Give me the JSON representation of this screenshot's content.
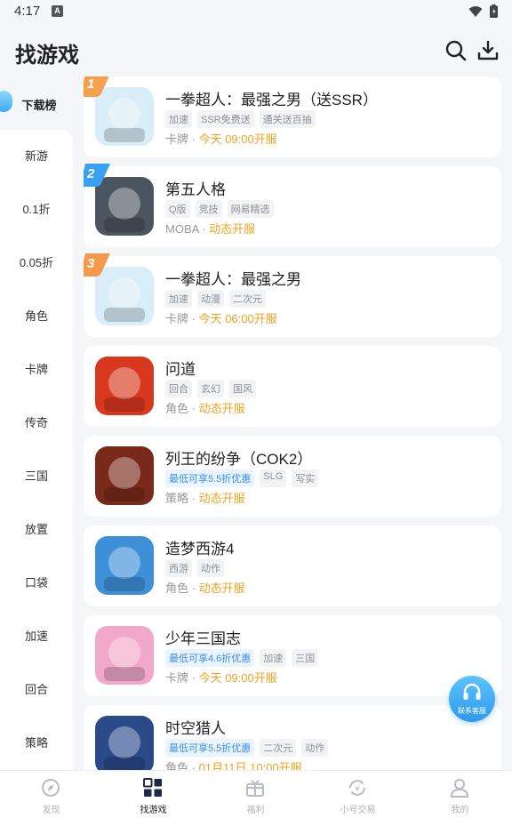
{
  "status": {
    "time": "4:17",
    "notif": "A"
  },
  "header": {
    "title": "找游戏"
  },
  "sidebar": {
    "active": "下载榜",
    "items": [
      "新游",
      "0.1折",
      "0.05折",
      "角色",
      "卡牌",
      "传奇",
      "三国",
      "放置",
      "口袋",
      "加速",
      "回合",
      "策略"
    ]
  },
  "games": [
    {
      "rank": "1",
      "name": "一拳超人：最强之男（送SSR）",
      "tags": [
        {
          "t": "加速"
        },
        {
          "t": "SSR免费送"
        },
        {
          "t": "通关送百抽"
        }
      ],
      "genre": "卡牌",
      "schedule": "今天 09:00开服",
      "icon_color": "#d9eef8"
    },
    {
      "rank": "2",
      "name": "第五人格",
      "tags": [
        {
          "t": "Q版"
        },
        {
          "t": "竞技"
        },
        {
          "t": "网易精选"
        }
      ],
      "genre": "MOBA",
      "schedule": "动态开服",
      "icon_color": "#4a5560"
    },
    {
      "rank": "3",
      "name": "一拳超人：最强之男",
      "tags": [
        {
          "t": "加速"
        },
        {
          "t": "动漫"
        },
        {
          "t": "二次元"
        }
      ],
      "genre": "卡牌",
      "schedule": "今天 06:00开服",
      "icon_color": "#d9eef8"
    },
    {
      "rank": "",
      "name": "问道",
      "tags": [
        {
          "t": "回合"
        },
        {
          "t": "玄幻"
        },
        {
          "t": "国风"
        }
      ],
      "genre": "角色",
      "schedule": "动态开服",
      "icon_color": "#d8381d"
    },
    {
      "rank": "",
      "name": "列王的纷争（COK2）",
      "tags": [
        {
          "t": "最低可享5.5折优惠",
          "blue": true
        },
        {
          "t": "SLG"
        },
        {
          "t": "写实"
        }
      ],
      "genre": "策略",
      "schedule": "动态开服",
      "icon_color": "#7a2a1a"
    },
    {
      "rank": "",
      "name": "造梦西游4",
      "tags": [
        {
          "t": "西游"
        },
        {
          "t": "动作"
        }
      ],
      "genre": "角色",
      "schedule": "动态开服",
      "icon_color": "#3d8fd8"
    },
    {
      "rank": "",
      "name": "少年三国志",
      "tags": [
        {
          "t": "最低可享4.6折优惠",
          "blue": true
        },
        {
          "t": "加速"
        },
        {
          "t": "三国"
        }
      ],
      "genre": "卡牌",
      "schedule": "今天 09:00开服",
      "icon_color": "#f2a8c8"
    },
    {
      "rank": "",
      "name": "时空猎人",
      "tags": [
        {
          "t": "最低可享5.5折优惠",
          "blue": true
        },
        {
          "t": "二次元"
        },
        {
          "t": "动作"
        }
      ],
      "genre": "角色",
      "schedule": "01月11日 10:00开服",
      "icon_color": "#2a4a8a"
    }
  ],
  "service": {
    "label": "联系客服"
  },
  "tabs": [
    {
      "label": "发现",
      "icon": "compass-icon"
    },
    {
      "label": "找游戏",
      "icon": "grid-icon",
      "active": true
    },
    {
      "label": "福利",
      "icon": "gift-icon"
    },
    {
      "label": "小号交易",
      "icon": "exchange-icon"
    },
    {
      "label": "我的",
      "icon": "user-icon"
    }
  ],
  "colors": {
    "accent": "#3a8ef0",
    "schedule": "#f0a21f",
    "rank1": "#f5a04a",
    "rank2": "#3aa0f0",
    "rank3": "#f59a4a"
  }
}
